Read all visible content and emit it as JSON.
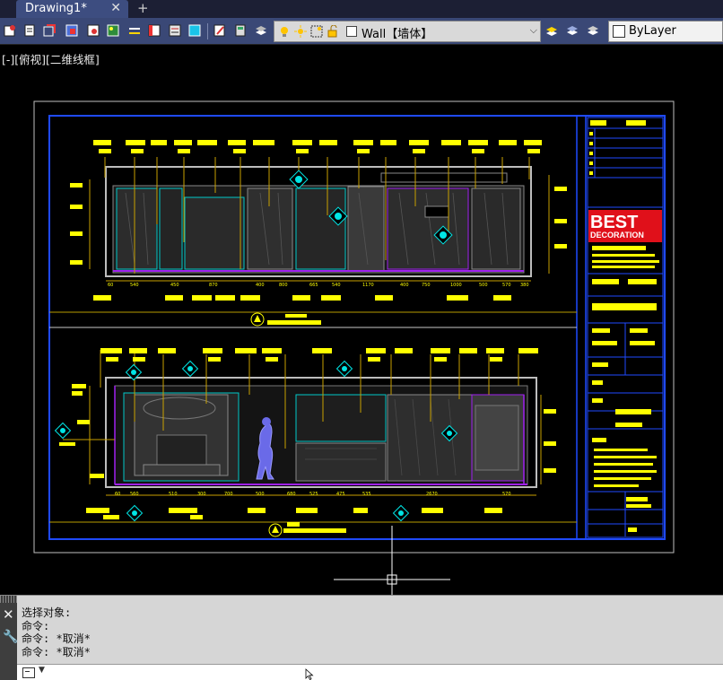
{
  "tabs": [
    {
      "label": "Drawing1*",
      "close": "✕"
    }
  ],
  "tab_add": "+",
  "toolbar": {
    "layer_name": "Wall【墙体】",
    "color": "ByLayer"
  },
  "viewport_label": "[-][俯视][二维线框]",
  "drawing": {
    "logo_main": "BEST",
    "logo_sub": "DECORATION"
  },
  "command": {
    "history": [
      "选择对象:",
      "命令:",
      "命令: *取消*",
      "命令: *取消*"
    ],
    "input_value": ""
  },
  "colors": {
    "background": "#000000",
    "frame_blue": "#1f4aff",
    "annotation_yellow": "#ffff00",
    "section_cyan": "#00c8c8",
    "logo_red": "#e0101a"
  }
}
